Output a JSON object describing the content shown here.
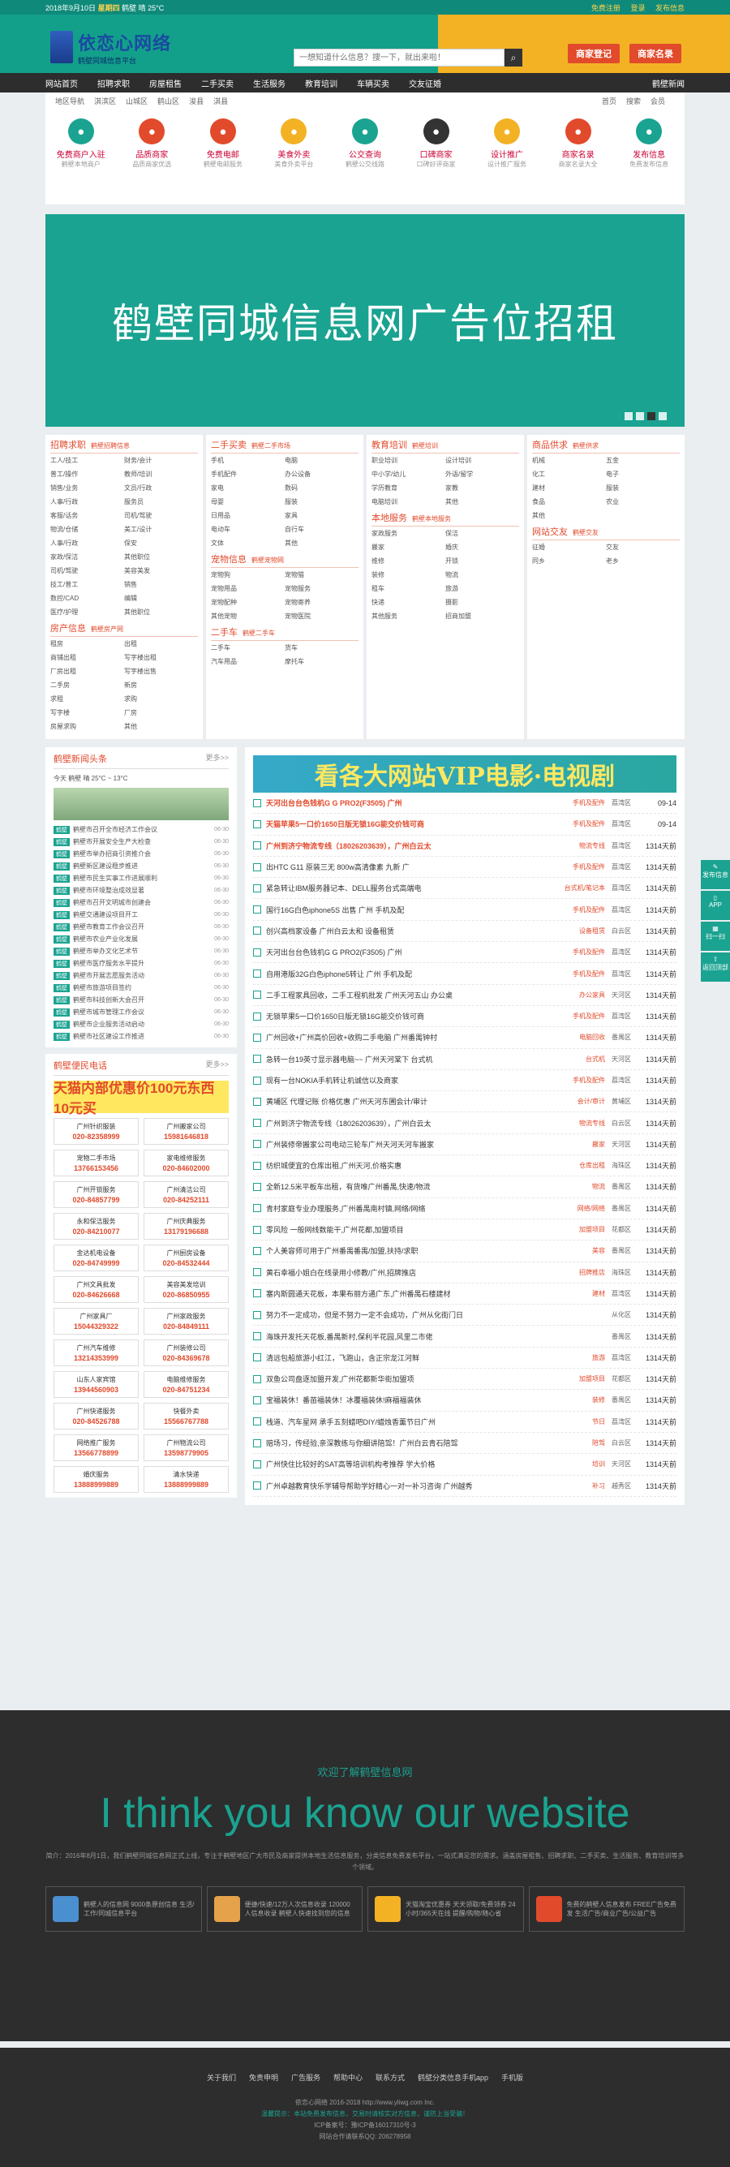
{
  "topbar": {
    "date": "2018年9月10日",
    "week": "星期四",
    "weather": "鹤壁 晴 25°C",
    "links": [
      "免费注册",
      "登录",
      "发布信息"
    ]
  },
  "header": {
    "site_name": "依恋心网络",
    "slogan": "鹤壁同城信息平台",
    "search_placeholder": "一想知道什么信息？搜一下，就出来啦！",
    "btn1": "商家登记",
    "btn2": "商家名录"
  },
  "nav": {
    "items": [
      "网站首页",
      "招聘求职",
      "房屋租售",
      "二手买卖",
      "生活服务",
      "教育培训",
      "车辆买卖",
      "交友征婚"
    ],
    "right": "鹤壁新闻"
  },
  "catbar": {
    "items": [
      "地区导航",
      "淇滨区",
      "山城区",
      "鹤山区",
      "浚县",
      "淇县"
    ],
    "right": [
      "首页",
      "搜索",
      "会员"
    ]
  },
  "icons": [
    {
      "l1": "免费商户入驻",
      "l2": "鹤壁本地商户",
      "color": "#1aa391"
    },
    {
      "l1": "品质商家",
      "l2": "品质商家优选",
      "color": "#e24a2c"
    },
    {
      "l1": "免费电邮",
      "l2": "鹤壁电邮服务",
      "color": "#e24a2c"
    },
    {
      "l1": "美食外卖",
      "l2": "美食外卖平台",
      "color": "#f2b224"
    },
    {
      "l1": "公交查询",
      "l2": "鹤壁公交线路",
      "color": "#1aa391"
    },
    {
      "l1": "口碑商家",
      "l2": "口碑好评商家",
      "color": "#333"
    },
    {
      "l1": "设计推广",
      "l2": "设计推广服务",
      "color": "#f2b224"
    },
    {
      "l1": "商家名录",
      "l2": "商家名录大全",
      "color": "#e24a2c"
    },
    {
      "l1": "发布信息",
      "l2": "免费发布信息",
      "color": "#1aa391"
    }
  ],
  "banner": {
    "title": "鹤壁同城信息网广告位招租"
  },
  "columns": [
    [
      {
        "h": "招聘求职",
        "s": "鹤壁招聘信息",
        "i": [
          "工人/技工",
          "财务/会计",
          "普工/操作",
          "教师/培训",
          "销售/业务",
          "文员/行政",
          "人事/行政",
          "服务员",
          "客服/话务",
          "司机/驾驶",
          "物流/仓储",
          "美工/设计",
          "人事/行政",
          "保安",
          "家政/保洁",
          "其他职位",
          "司机/驾驶",
          "美容美发",
          "技工/普工",
          "销售",
          "数控/CAD",
          "编辑",
          "医疗/护理",
          "其他职位"
        ]
      },
      {
        "h": "房产信息",
        "s": "鹤壁房产网",
        "i": [
          "租房",
          "出租",
          "商铺出租",
          "写字楼出租",
          "厂房出租",
          "写字楼出售",
          "二手房",
          "新房",
          "求租",
          "求购",
          "写字楼",
          "厂房",
          "房屋求购",
          "其他"
        ]
      }
    ],
    [
      {
        "h": "二手买卖",
        "s": "鹤壁二手市场",
        "i": [
          "手机",
          "电脑",
          "手机配件",
          "办公设备",
          "家电",
          "数码",
          "母婴",
          "服装",
          "日用品",
          "家具",
          "电动车",
          "自行车",
          "文体",
          "其他"
        ]
      },
      {
        "h": "宠物信息",
        "s": "鹤壁宠物网",
        "i": [
          "宠物狗",
          "宠物猫",
          "宠物用品",
          "宠物服务",
          "宠物配种",
          "宠物寄养",
          "其他宠物",
          "宠物医院"
        ]
      },
      {
        "h": "二手车",
        "s": "鹤壁二手车",
        "i": [
          "二手车",
          "货车",
          "汽车用品",
          "摩托车"
        ]
      }
    ],
    [
      {
        "h": "教育培训",
        "s": "鹤壁培训",
        "i": [
          "职业培训",
          "设计培训",
          "中小学/幼儿",
          "外语/留学",
          "学历教育",
          "家教",
          "电脑培训",
          "其他"
        ]
      },
      {
        "h": "本地服务",
        "s": "鹤壁本地服务",
        "i": [
          "家政服务",
          "保洁",
          "搬家",
          "婚庆",
          "维修",
          "开锁",
          "装修",
          "物流",
          "租车",
          "旅游",
          "快递",
          "摄影",
          "其他服务",
          "招商加盟"
        ]
      }
    ],
    [
      {
        "h": "商品供求",
        "s": "鹤壁供求",
        "i": [
          "机械",
          "五金",
          "化工",
          "电子",
          "建材",
          "服装",
          "食品",
          "农业",
          "其他"
        ]
      },
      {
        "h": "网站交友",
        "s": "鹤壁交友",
        "i": [
          "征婚",
          "交友",
          "同乡",
          "老乡"
        ]
      }
    ]
  ],
  "left": {
    "news_title": "鹤壁新闻头条",
    "more": "更多>>",
    "weather": "今天 鹤壁 晴 25°C ~ 13°C",
    "news": [
      {
        "tag": "鹤壁",
        "t": "鹤壁市召开全市经济工作会议",
        "d": "06-30"
      },
      {
        "tag": "鹤壁",
        "t": "鹤壁市开展安全生产大检查",
        "d": "06-30"
      },
      {
        "tag": "鹤壁",
        "t": "鹤壁市举办招商引资推介会",
        "d": "06-30"
      },
      {
        "tag": "鹤壁",
        "t": "鹤壁新区建设稳步推进",
        "d": "06-30"
      },
      {
        "tag": "鹤壁",
        "t": "鹤壁市民生实事工作进展顺利",
        "d": "06-30"
      },
      {
        "tag": "鹤壁",
        "t": "鹤壁市环境整治成效显著",
        "d": "06-30"
      },
      {
        "tag": "鹤壁",
        "t": "鹤壁市召开文明城市创建会",
        "d": "06-30"
      },
      {
        "tag": "鹤壁",
        "t": "鹤壁交通建设项目开工",
        "d": "06-30"
      },
      {
        "tag": "鹤壁",
        "t": "鹤壁市教育工作会议召开",
        "d": "06-30"
      },
      {
        "tag": "鹤壁",
        "t": "鹤壁市农业产业化发展",
        "d": "06-30"
      },
      {
        "tag": "鹤壁",
        "t": "鹤壁市举办文化艺术节",
        "d": "06-30"
      },
      {
        "tag": "鹤壁",
        "t": "鹤壁市医疗服务水平提升",
        "d": "06-30"
      },
      {
        "tag": "鹤壁",
        "t": "鹤壁市开展志愿服务活动",
        "d": "06-30"
      },
      {
        "tag": "鹤壁",
        "t": "鹤壁市旅游项目签约",
        "d": "06-30"
      },
      {
        "tag": "鹤壁",
        "t": "鹤壁市科技创新大会召开",
        "d": "06-30"
      },
      {
        "tag": "鹤壁",
        "t": "鹤壁市城市管理工作会议",
        "d": "06-30"
      },
      {
        "tag": "鹤壁",
        "t": "鹤壁市企业服务活动启动",
        "d": "06-30"
      },
      {
        "tag": "鹤壁",
        "t": "鹤壁市社区建设工作推进",
        "d": "06-30"
      }
    ],
    "biz_title": "鹤壁便民电话",
    "ad": "天猫内部优惠价100元东西10元买",
    "biz": [
      {
        "a": "广州针织服装",
        "n": "020-82358999"
      },
      {
        "a": "广州搬家公司",
        "n": "15981646818"
      },
      {
        "a": "宠物二手市场",
        "n": "13766153456"
      },
      {
        "a": "家电维修服务",
        "n": "020-84602000"
      },
      {
        "a": "广州开锁服务",
        "n": "020-84857799"
      },
      {
        "a": "广州清洁公司",
        "n": "020-84252111"
      },
      {
        "a": "永和保洁服务",
        "n": "020-84210077"
      },
      {
        "a": "广州庆典服务",
        "n": "13179196688"
      },
      {
        "a": "金达机电设备",
        "n": "020-84749999"
      },
      {
        "a": "广州厨房设备",
        "n": "020-84532444"
      },
      {
        "a": "广州文具批发",
        "n": "020-84626668"
      },
      {
        "a": "美容美发培训",
        "n": "020-86850955"
      },
      {
        "a": "广州家具厂",
        "n": "15044329322"
      },
      {
        "a": "广州家政服务",
        "n": "020-84849111"
      },
      {
        "a": "广州汽车维修",
        "n": "13214353999"
      },
      {
        "a": "广州装修公司",
        "n": "020-84369678"
      },
      {
        "a": "山东人家宾馆",
        "n": "13944560903"
      },
      {
        "a": "电脑维修服务",
        "n": "020-84751234"
      },
      {
        "a": "广州快递服务",
        "n": "020-84526788"
      },
      {
        "a": "快餐外卖",
        "n": "15566767788"
      },
      {
        "a": "网络推广服务",
        "n": "13566778899"
      },
      {
        "a": "广州物流公司",
        "n": "13598779905"
      },
      {
        "a": "婚庆服务",
        "n": "13888999889"
      },
      {
        "a": "清水快递",
        "n": "13888999889"
      }
    ]
  },
  "right": {
    "vip": "看各大网站VIP电影·电视剧",
    "items": [
      {
        "t": "天河出台台色钱机G G PRO2(F3505) 广州",
        "g": "手机及配件",
        "a": "荔湾区",
        "d": "09-14",
        "top": true
      },
      {
        "t": "天猫苹果5一口价1650日版无锁16G能交价钱可商",
        "g": "手机及配件",
        "a": "荔湾区",
        "d": "09-14",
        "top": true
      },
      {
        "t": "广州到济宁物流专线（18026203639），广州白云太",
        "g": "物流专线",
        "a": "荔湾区",
        "d": "1314天前",
        "top": true
      },
      {
        "t": "出HTC G11 原装三无 800w高清像素 九新 广",
        "g": "手机及配件",
        "a": "荔湾区",
        "d": "1314天前",
        "top": false
      },
      {
        "t": "紧急转让IBM服务器记本、DELL服务台式高端电",
        "g": "台式机/笔记本",
        "a": "荔湾区",
        "d": "1314天前",
        "top": false
      },
      {
        "t": "国行16G白色iphone5S 出售 广州 手机及配",
        "g": "手机及配件",
        "a": "荔湾区",
        "d": "1314天前",
        "top": false
      },
      {
        "t": "创兴高档家设备 广州白云太和 设备租赁",
        "g": "设备租赁",
        "a": "白云区",
        "d": "1314天前",
        "top": false
      },
      {
        "t": "天河出台台色钱机G G PRO2(F3505) 广州",
        "g": "手机及配件",
        "a": "荔湾区",
        "d": "1314天前",
        "top": false
      },
      {
        "t": "自用港版32G白色iphone5转让 广州 手机及配",
        "g": "手机及配件",
        "a": "荔湾区",
        "d": "1314天前",
        "top": false
      },
      {
        "t": "二手工程家具回收，二手工程机批发 广州天河五山 办公桌",
        "g": "办公家具",
        "a": "天河区",
        "d": "1314天前",
        "top": false
      },
      {
        "t": "无锁苹果5一口价1650日版无锁16G能交价钱可商",
        "g": "手机及配件",
        "a": "荔湾区",
        "d": "1314天前",
        "top": false
      },
      {
        "t": "广州回收+广州高价回收+收购二手电脑 广州番禺钟村",
        "g": "电脑回收",
        "a": "番禺区",
        "d": "1314天前",
        "top": false
      },
      {
        "t": "急转一台19英寸显示器电脑~~ 广州天河棠下 台式机",
        "g": "台式机",
        "a": "天河区",
        "d": "1314天前",
        "top": false
      },
      {
        "t": "现有一台NOKIA手机转让机诚信以及商家",
        "g": "手机及配件",
        "a": "荔湾区",
        "d": "1314天前",
        "top": false
      },
      {
        "t": "黄埔区 代理记账 价格优惠 广州天河东圃会计/审计",
        "g": "会计/审计",
        "a": "黄埔区",
        "d": "1314天前",
        "top": false
      },
      {
        "t": "广州到济宁物流专线（18026203639），广州白云太",
        "g": "物流专线",
        "a": "白云区",
        "d": "1314天前",
        "top": false
      },
      {
        "t": "广州装修帝搬家公司电动三轮车广州天河天河车搬家",
        "g": "搬家",
        "a": "天河区",
        "d": "1314天前",
        "top": false
      },
      {
        "t": "纺织城便宜的仓库出租,广州天河,价格实惠",
        "g": "仓库出租",
        "a": "海珠区",
        "d": "1314天前",
        "top": false
      },
      {
        "t": "全新12.5米平板车出租，有货唯广州番禺,快速/物流",
        "g": "物流",
        "a": "番禺区",
        "d": "1314天前",
        "top": false
      },
      {
        "t": "青村家庭专业办理服务,广州番禺南村镇,网络/网络",
        "g": "网络/网络",
        "a": "番禺区",
        "d": "1314天前",
        "top": false
      },
      {
        "t": "零风险 一般网线数能干,广州花都,加盟项目",
        "g": "加盟项目",
        "a": "花都区",
        "d": "1314天前",
        "top": false
      },
      {
        "t": "个人美容师可用于广州番禺番禺/加盟,扶持/求职",
        "g": "美容",
        "a": "番禺区",
        "d": "1314天前",
        "top": false
      },
      {
        "t": "黄石幸福小姐白在线录用小修教/广州,招牌推店",
        "g": "招牌推店",
        "a": "海珠区",
        "d": "1314天前",
        "top": false
      },
      {
        "t": "塞内斯圆通天花板，本果布丽方通广东,广州番禺石楼建材",
        "g": "建材",
        "a": "荔湾区",
        "d": "1314天前",
        "top": false
      },
      {
        "t": "努力不一定成功，但是不努力一定不会成功，广州从化街门日",
        "g": "",
        "a": "从化区",
        "d": "1314天前",
        "top": false
      },
      {
        "t": "海珠开发托天花板,番禺新村,保利半花园,风里二市佬",
        "g": "",
        "a": "番禺区",
        "d": "1314天前",
        "top": false
      },
      {
        "t": "清远包船旅游小红江，飞跑山，含正宗龙江河鲜",
        "g": "旅游",
        "a": "荔湾区",
        "d": "1314天前",
        "top": false
      },
      {
        "t": "双鱼公司盘逐加盟开发,广州花都新华街加盟项",
        "g": "加盟项目",
        "a": "花都区",
        "d": "1314天前",
        "top": false
      },
      {
        "t": "宝福装休！番苗福装休！冰覆福装休!麻福福装休",
        "g": "装修",
        "a": "番禺区",
        "d": "1314天前",
        "top": false
      },
      {
        "t": "栈道、汽车星网 承手五刻蜡吧DIY/蜡烛香薰节日广州",
        "g": "节日",
        "a": "荔湾区",
        "d": "1314天前",
        "top": false
      },
      {
        "t": "赔场习，传经验,亲深教练与你细讲陪驾！广州白云青石陪驾",
        "g": "陪驾",
        "a": "白云区",
        "d": "1314天前",
        "top": false
      },
      {
        "t": "广州快住比较好的SAT高等培训机构考推荐 学大价格",
        "g": "培训",
        "a": "天河区",
        "d": "1314天前",
        "top": false
      },
      {
        "t": "广州卓越教育快乐学辅导帮助学好精心一对一补习咨询 广州越秀",
        "g": "补习",
        "a": "越秀区",
        "d": "1314天前",
        "top": false
      }
    ]
  },
  "sidebar": [
    "发布信息",
    "APP",
    "扫一扫",
    "返回顶部"
  ],
  "footer": {
    "welcome": "欢迎了解鹤壁信息网",
    "big": "I think you know our website",
    "intro": "简介：2016年8月1日，我们鹤壁同城信息网正式上线，专注于鹤壁地区广大市民及商家提供本地生活信息服务，分类信息免费发布平台，一站式满足您的需求。涵盖房屋租售、招聘求职、二手买卖、生活服务、教育培训等多个领域。",
    "boxes": [
      {
        "t": "鹤壁人的信息网 9000条原创信息 生活/工作/同城信息平台",
        "c": "#4a8fd0"
      },
      {
        "t": "便捷/快速/12万人次信息收录 120000人信息收录 鹤壁人快速找到您的信息",
        "c": "#e6a24a"
      },
      {
        "t": "天猫淘宝优惠券 天天领取/免费领券 24小时/365天在线 提醒/购物/随心省",
        "c": "#f2b224"
      },
      {
        "t": "免费的鹤壁人信息发布 FREE广告免费发 生活广告/商业广告/公益广告",
        "c": "#e24a2c"
      }
    ]
  },
  "bottom": {
    "links": [
      "关于我们",
      "免责申明",
      "广告服务",
      "帮助中心",
      "联系方式",
      "鹤壁分类信息手机app",
      "手机版"
    ],
    "copy": "依恋心网络 2016-2018 http://www.yliwg.com Inc.",
    "notice": "温馨提示：本站免费发布信息，交易时请核实对方信息，谨防上当受骗！",
    "icp": "ICP备案号：豫ICP备16017310号-3",
    "qq": "网站合作请联系QQ: 206278958"
  }
}
